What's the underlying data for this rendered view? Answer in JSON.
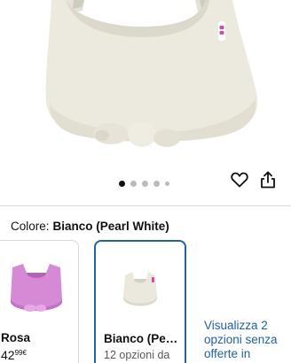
{
  "gallery": {
    "image_alt": "Vasino bianco",
    "image_count": 5,
    "active_index": 0,
    "wishlist_icon": "heart-icon",
    "share_icon": "share-icon"
  },
  "variation": {
    "label": "Colore:",
    "selected_value": "Bianco (Pearl White)",
    "swatches": [
      {
        "name": "Rosa",
        "price_whole": "42",
        "price_fraction": "99",
        "currency": "€",
        "color": "#d68ad6"
      },
      {
        "name": "Bianco (Pearl White)",
        "subtitle": "12 opzioni da",
        "color": "#ebe8de"
      }
    ],
    "more_options": "Visualizza 2 opzioni senza offerte in"
  }
}
